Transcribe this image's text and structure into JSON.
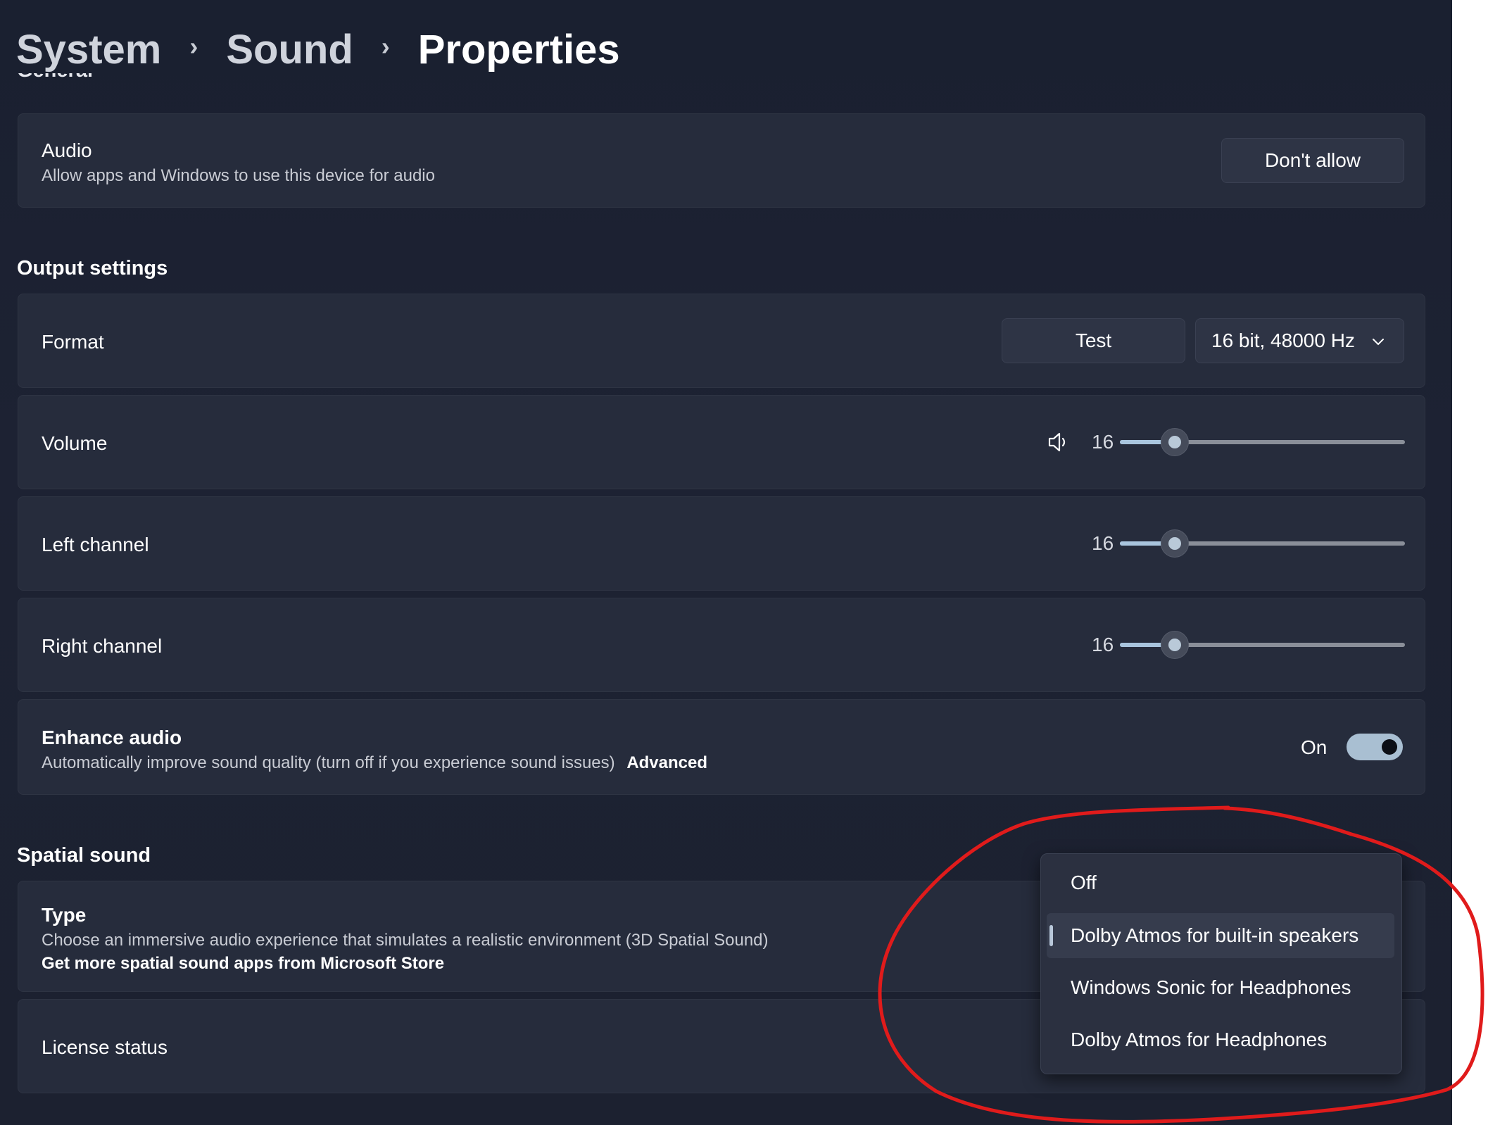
{
  "breadcrumb": {
    "items": [
      "System",
      "Sound",
      "Properties"
    ],
    "separator": "›"
  },
  "general": {
    "heading": "General",
    "audio": {
      "title": "Audio",
      "subtitle": "Allow apps and Windows to use this device for audio",
      "button": "Don't allow"
    }
  },
  "output": {
    "heading": "Output settings",
    "format": {
      "label": "Format",
      "test_button": "Test",
      "selected": "16 bit, 48000 Hz"
    },
    "volume": {
      "label": "Volume",
      "value": "16",
      "level": 0.16
    },
    "left": {
      "label": "Left channel",
      "value": "16",
      "level": 0.16
    },
    "right": {
      "label": "Right channel",
      "value": "16",
      "level": 0.16
    },
    "enhance": {
      "title": "Enhance audio",
      "subtitle": "Automatically improve sound quality (turn off if you experience sound issues)",
      "advanced": "Advanced",
      "state": "On"
    }
  },
  "spatial": {
    "heading": "Spatial sound",
    "type": {
      "title": "Type",
      "subtitle": "Choose an immersive audio experience that simulates a realistic environment (3D Spatial Sound)",
      "store_link": "Get more spatial sound apps from Microsoft Store"
    },
    "license": {
      "label": "License status"
    },
    "menu": {
      "options": [
        "Off",
        "Dolby Atmos for built-in speakers",
        "Windows Sonic for Headphones",
        "Dolby Atmos for Headphones"
      ],
      "selected_index": 1
    }
  },
  "colors": {
    "accent": "#a9c5de",
    "annotation": "#e01b1b",
    "background": "#1c2130",
    "card": "#262c3c"
  },
  "icons": {
    "volume": "speaker-icon",
    "chevron": "chevron-down-icon",
    "separator": "chevron-right"
  }
}
